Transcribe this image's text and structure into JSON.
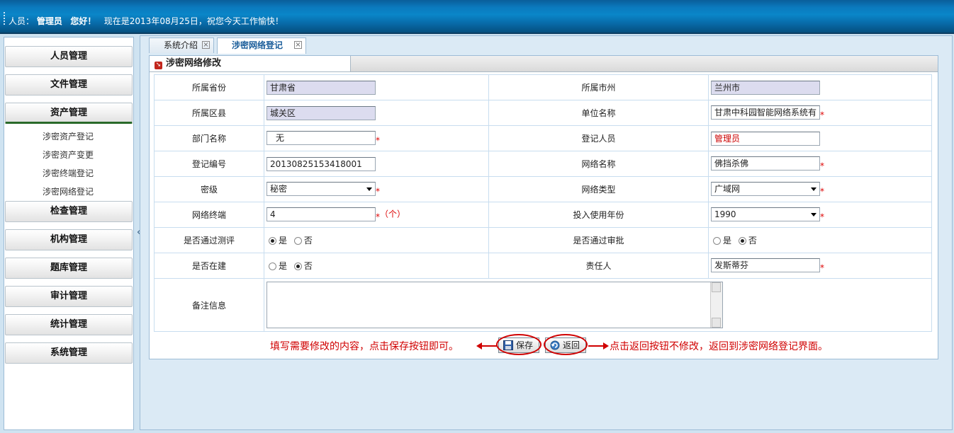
{
  "topbar": {
    "user_label": "人员：",
    "user_name": "管理员",
    "greeting": "您好！",
    "date_text": "现在是2013年08月25日，祝您今天工作愉快！"
  },
  "sidebar": {
    "menus": [
      {
        "label": "人员管理"
      },
      {
        "label": "文件管理"
      },
      {
        "label": "资产管理"
      },
      {
        "label": "检查管理"
      },
      {
        "label": "机构管理"
      },
      {
        "label": "题库管理"
      },
      {
        "label": "审计管理"
      },
      {
        "label": "统计管理"
      },
      {
        "label": "系统管理"
      }
    ],
    "sub_items": [
      "涉密资产登记",
      "涉密资产变更",
      "涉密终端登记",
      "涉密网络登记"
    ],
    "collapse_glyph": "«"
  },
  "tabs": [
    {
      "label": "系统介绍"
    },
    {
      "label": "涉密网络登记"
    }
  ],
  "panel": {
    "title": "涉密网络修改"
  },
  "form": {
    "province_label": "所属省份",
    "province_value": "甘肃省",
    "city_label": "所属市州",
    "city_value": "兰州市",
    "district_label": "所属区县",
    "district_value": "城关区",
    "unit_label": "单位名称",
    "unit_value": "甘肃中科园智能网络系统有",
    "dept_label": "部门名称",
    "dept_value": "无",
    "registrant_label": "登记人员",
    "registrant_value": "管理员",
    "regno_label": "登记编号",
    "regno_value": "20130825153418001",
    "netname_label": "网络名称",
    "netname_value": "佛挡杀佛",
    "secret_label": "密级",
    "secret_value": "秘密",
    "nettype_label": "网络类型",
    "nettype_value": "广域网",
    "terminals_label": "网络终端",
    "terminals_value": "4",
    "terminals_unit": "（个）",
    "year_label": "投入使用年份",
    "year_value": "1990",
    "eval_label": "是否通过测评",
    "approve_label": "是否通过审批",
    "building_label": "是否在建",
    "owner_label": "责任人",
    "owner_value": "发斯蒂芬",
    "remark_label": "备注信息",
    "yes": "是",
    "no": "否",
    "required_mark": "*"
  },
  "actions": {
    "save_label": "保存",
    "back_label": "返回",
    "annotation_left": "填写需要修改的内容，点击保存按钮即可。",
    "annotation_right": "点击返回按钮不修改，返回到涉密网络登记界面。"
  },
  "colors": {
    "accent_blue": "#0a79bd",
    "annotation_red": "#d00000",
    "readonly_fill": "#dcdcef"
  }
}
